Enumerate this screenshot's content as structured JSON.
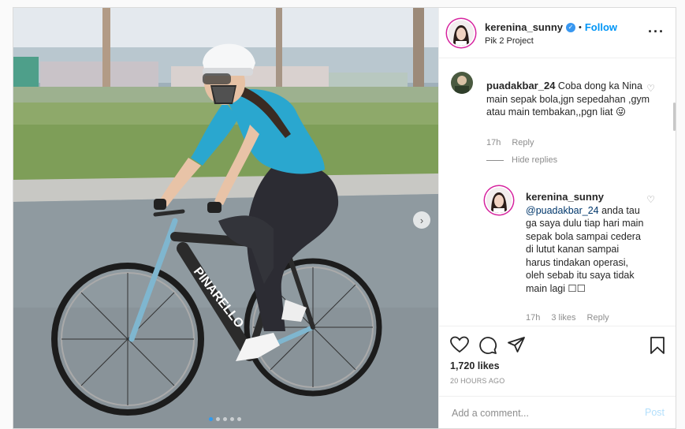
{
  "post": {
    "author": "kerenina_sunny",
    "location": "Pik 2 Project",
    "follow_label": "Follow",
    "bullet": "•",
    "more_icon": "more-horizontal-icon",
    "image_count": 5,
    "active_image_index": 1
  },
  "comments": [
    {
      "username": "puadakbar_24",
      "text": "Coba dong ka Nina main sepak bola,jgn sepedahan ,gym atau main tembakan,,pgn liat 😜",
      "time": "17h",
      "reply_label": "Reply"
    }
  ],
  "hide_replies_label": "Hide replies",
  "reply": {
    "username": "kerenina_sunny",
    "mention": "@puadakbar_24",
    "text": "anda tau ga saya dulu tiap hari main sepak bola sampai cedera di lutut kanan sampai harus tindakan operasi, oleh sebab itu saya tidak main lagi ☐☐",
    "time": "17h",
    "likes": "3 likes",
    "reply_label": "Reply"
  },
  "engagement": {
    "likes": "1,720 likes",
    "time_ago": "20 HOURS AGO"
  },
  "add_comment": {
    "placeholder": "Add a comment...",
    "post_label": "Post"
  },
  "colors": {
    "accent": "#0095f6",
    "post_disabled": "#b2dffc",
    "jersey": "#2aa7cf"
  }
}
